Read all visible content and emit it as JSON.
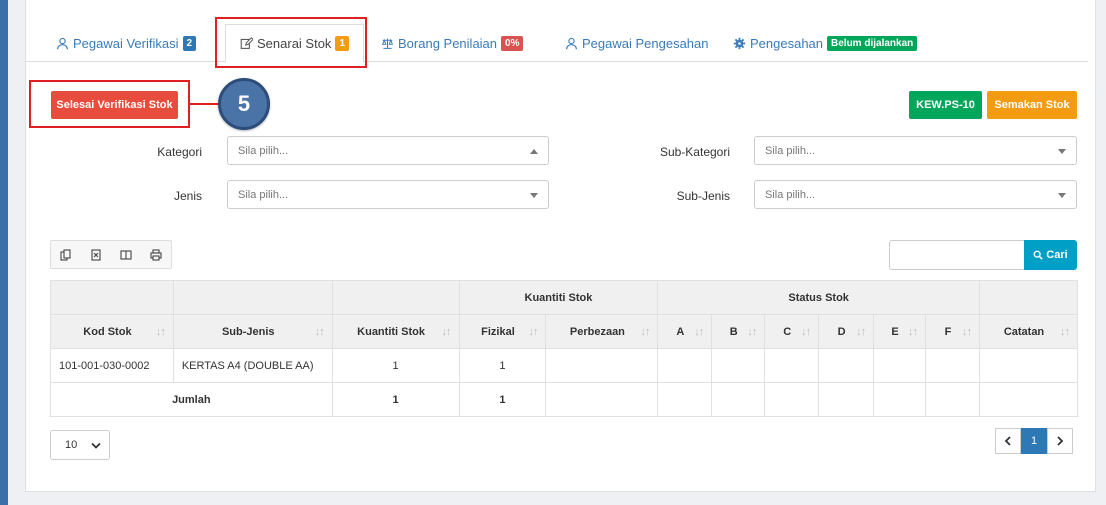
{
  "tabs": [
    {
      "label": "Pegawai Verifikasi",
      "badge": "2",
      "icon": "user-icon"
    },
    {
      "label": "Senarai Stok",
      "badge": "1",
      "icon": "edit-icon"
    },
    {
      "label": "Borang Penilaian",
      "badge": "0%",
      "icon": "balance-scale-icon"
    },
    {
      "label": "Pegawai Pengesahan",
      "icon": "user-icon"
    },
    {
      "label": "Pengesahan",
      "badge": "Belum dijalankan",
      "icon": "gear-icon"
    }
  ],
  "buttons": {
    "selesai": "Selesai Verifikasi Stok",
    "kew": "KEW.PS-10",
    "semakan": "Semakan Stok",
    "cari": "Cari"
  },
  "step_number": "5",
  "filters": {
    "kategori": {
      "label": "Kategori",
      "placeholder": "Sila pilih..."
    },
    "sub_kategori": {
      "label": "Sub-Kategori",
      "placeholder": "Sila pilih..."
    },
    "jenis": {
      "label": "Jenis",
      "placeholder": "Sila pilih..."
    },
    "sub_jenis": {
      "label": "Sub-Jenis",
      "placeholder": "Sila pilih..."
    }
  },
  "table": {
    "group_headers": {
      "kuantiti": "Kuantiti Stok",
      "status": "Status Stok"
    },
    "columns": {
      "kod": "Kod Stok",
      "subjenis": "Sub-Jenis",
      "kuantiti": "Kuantiti Stok",
      "fizikal": "Fizikal",
      "perbezaan": "Perbezaan",
      "a": "A",
      "b": "B",
      "c": "C",
      "d": "D",
      "e": "E",
      "f": "F",
      "catatan": "Catatan"
    },
    "row": {
      "kod": "101-001-030-0002",
      "subjenis": "KERTAS A4 (DOUBLE AA)",
      "kuantiti": "1",
      "fizikal": "1"
    },
    "total": {
      "label": "Jumlah",
      "kuantiti": "1",
      "fizikal": "1"
    }
  },
  "pagination": {
    "page_size": "10",
    "current_page": "1"
  },
  "colors": {
    "accent": "#2e78b5",
    "danger": "#e74c3c",
    "success": "#00a65a",
    "warning": "#f39c12",
    "info": "#00a0c6"
  }
}
